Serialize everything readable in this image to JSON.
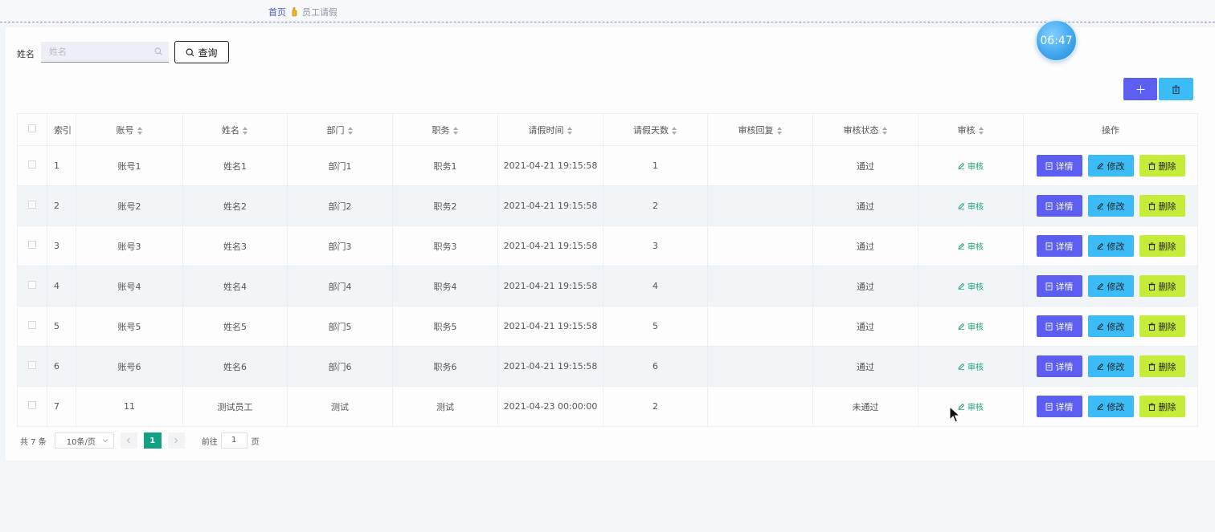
{
  "breadcrumb": {
    "home": "首页",
    "current": "员工请假"
  },
  "clock": {
    "time": "06:47"
  },
  "search": {
    "label": "姓名",
    "placeholder": "姓名",
    "value": "",
    "query_label": "查询"
  },
  "toolbar": {
    "add_icon": "plus-icon",
    "delete_icon": "trash-icon"
  },
  "table": {
    "columns": [
      "索引",
      "账号",
      "姓名",
      "部门",
      "职务",
      "请假时间",
      "请假天数",
      "审核回复",
      "审核状态",
      "审核",
      "操作"
    ],
    "review_label": "审核",
    "actions": {
      "detail": "详情",
      "edit": "修改",
      "delete": "删除"
    },
    "rows": [
      {
        "index": "1",
        "account": "账号1",
        "name": "姓名1",
        "dept": "部门1",
        "post": "职务1",
        "time": "2021-04-21 19:15:58",
        "days": "1",
        "reply": "",
        "status": "通过"
      },
      {
        "index": "2",
        "account": "账号2",
        "name": "姓名2",
        "dept": "部门2",
        "post": "职务2",
        "time": "2021-04-21 19:15:58",
        "days": "2",
        "reply": "",
        "status": "通过"
      },
      {
        "index": "3",
        "account": "账号3",
        "name": "姓名3",
        "dept": "部门3",
        "post": "职务3",
        "time": "2021-04-21 19:15:58",
        "days": "3",
        "reply": "",
        "status": "通过"
      },
      {
        "index": "4",
        "account": "账号4",
        "name": "姓名4",
        "dept": "部门4",
        "post": "职务4",
        "time": "2021-04-21 19:15:58",
        "days": "4",
        "reply": "",
        "status": "通过"
      },
      {
        "index": "5",
        "account": "账号5",
        "name": "姓名5",
        "dept": "部门5",
        "post": "职务5",
        "time": "2021-04-21 19:15:58",
        "days": "5",
        "reply": "",
        "status": "通过"
      },
      {
        "index": "6",
        "account": "账号6",
        "name": "姓名6",
        "dept": "部门6",
        "post": "职务6",
        "time": "2021-04-21 19:15:58",
        "days": "6",
        "reply": "",
        "status": "通过"
      },
      {
        "index": "7",
        "account": "11",
        "name": "测试员工",
        "dept": "测试",
        "post": "测试",
        "time": "2021-04-23 00:00:00",
        "days": "2",
        "reply": "",
        "status": "未通过"
      }
    ]
  },
  "pagination": {
    "total": "共 7 条",
    "page_size": "10条/页",
    "current_page": "1",
    "goto_label": "前往",
    "goto_value": "1",
    "goto_suffix": "页"
  },
  "colors": {
    "primary": "#5b5ef0",
    "info": "#3cbcf6",
    "warn": "#c6ec3a",
    "success": "#14a085"
  }
}
